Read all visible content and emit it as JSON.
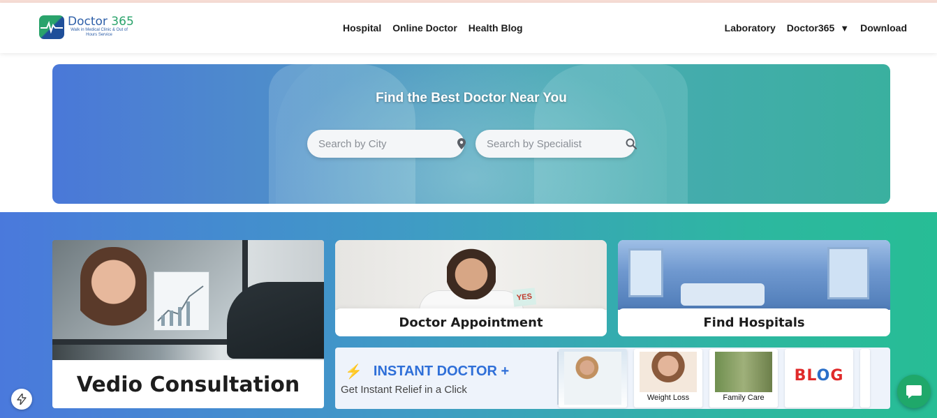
{
  "brand": {
    "name_part1": "Doctor",
    "name_part2": " 365",
    "tagline": "Walk in Medical Clinic & Out of Hours Service"
  },
  "nav": {
    "center": [
      "Hospital",
      "Online Doctor",
      "Health Blog"
    ],
    "right": {
      "laboratory": "Laboratory",
      "doctor365": "Doctor365",
      "download": "Download"
    }
  },
  "hero": {
    "title": "Find the Best Doctor Near You",
    "city_placeholder": "Search by City",
    "specialist_placeholder": "Search by Specialist"
  },
  "cards": {
    "vedio": "Vedio Consultation",
    "appointment": "Doctor Appointment",
    "hospitals": "Find Hospitals",
    "yes_sign": "YES"
  },
  "instant": {
    "title": "INSTANT DOCTOR +",
    "subtitle": "Get Instant Relief in a Click"
  },
  "thumbs": {
    "weight": "Weight Loss",
    "family": "Family Care",
    "blog_part1": "BL",
    "blog_part2": "O",
    "blog_part3": "G"
  },
  "colors": {
    "accent_blue": "#2f6fd8",
    "brand_green": "#2aa36b",
    "chat_green": "#1fa86a",
    "bolt_orange": "#f07b1e"
  },
  "icons": {
    "city": "location-pin-icon",
    "specialist": "search-icon",
    "instant": "lightning-bolt-icon",
    "chat": "chat-bubble-icon",
    "fab": "lightning-icon",
    "dropdown": "caret-down-icon"
  }
}
